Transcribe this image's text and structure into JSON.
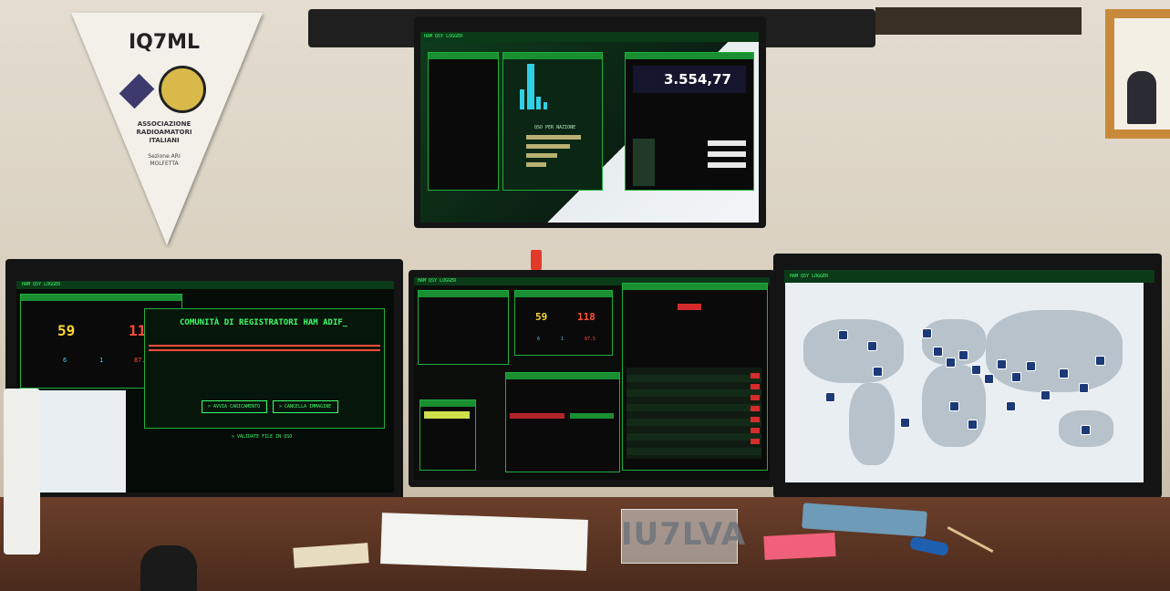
{
  "pennant": {
    "title": "IQ7ML",
    "association": "ASSOCIAZIONE RADIOAMATORI ITALIANI",
    "location": "Sezione ARI MOLFETTA"
  },
  "top_monitor": {
    "header": "HAM QSY LOGGER",
    "frequency": "3.554,77",
    "chart_title": "QSO PER NAZIONE"
  },
  "left_monitor": {
    "header": "HAM QSY LOGGER",
    "score_left": "59",
    "score_right": "118",
    "sub_left": "6",
    "sub_mid": "1",
    "sub_right": "87.5",
    "title": "COMUNITÀ DI REGISTRATORI HAM ADIF_",
    "button_upload": "> AVVIA CARICAMENTO",
    "button_clear": "> CANCELLA IMMAGINE",
    "link": "> VALIDATE FILE IN QSO"
  },
  "center_monitor": {
    "header": "HAM QSY LOGGER",
    "score_left": "59",
    "score_right": "118",
    "sub_left": "6",
    "sub_mid": "1",
    "sub_right": "87.5"
  },
  "right_monitor": {
    "header": "HAM QSY LOGGER"
  },
  "desk": {
    "sign_text": "IU7LVA"
  },
  "colors": {
    "terminal_green": "#3dff6a",
    "panel_border": "#1fae3c",
    "score_yellow": "#ffd633",
    "score_red": "#ff4d3a"
  }
}
